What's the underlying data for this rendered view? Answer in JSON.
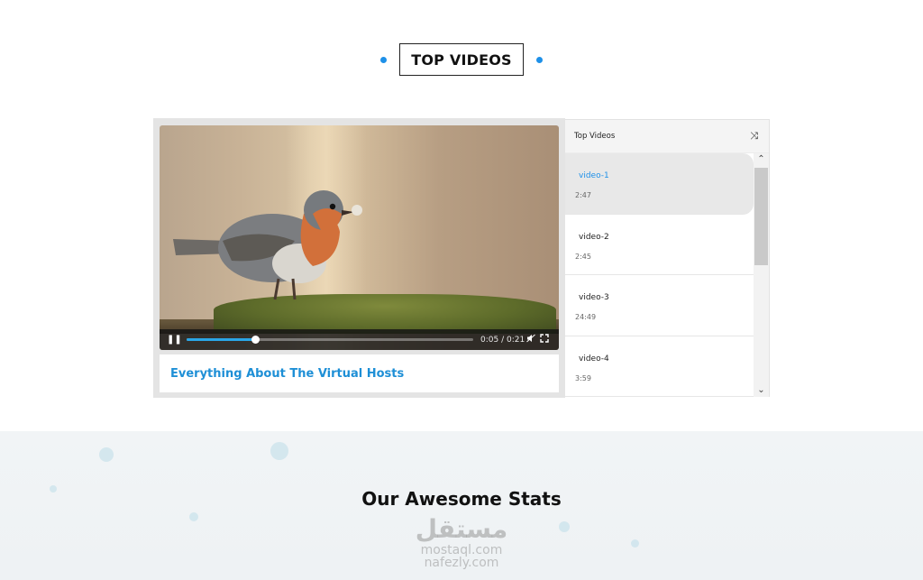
{
  "section": {
    "title": "TOP VIDEOS"
  },
  "player": {
    "caption": "Everything About The Virtual Hosts",
    "time_current": "0:05",
    "time_separator": "/",
    "time_total": "0:21",
    "progress": 0.24
  },
  "playlist": {
    "header": "Top Videos",
    "items": [
      {
        "title": "video-1",
        "duration": "2:47",
        "active": true
      },
      {
        "title": "video-2",
        "duration": "2:45",
        "active": false
      },
      {
        "title": "video-3",
        "duration": "24:49",
        "active": false
      },
      {
        "title": "video-4",
        "duration": "3:59",
        "active": false
      }
    ]
  },
  "stats": {
    "title": "Our Awesome Stats"
  },
  "watermark": {
    "logo": "مستقل",
    "line1": "mostaql.com",
    "line2": "nafezly.com"
  },
  "colors": {
    "accent": "#1e90e8",
    "progress": "#2aa6e6"
  },
  "icons": {
    "play_pause": "pause-icon",
    "mute": "speaker-muted-icon",
    "fullscreen": "fullscreen-icon",
    "shuffle": "shuffle-icon",
    "scroll_up": "chevron-up-icon",
    "scroll_down": "chevron-down-icon"
  }
}
